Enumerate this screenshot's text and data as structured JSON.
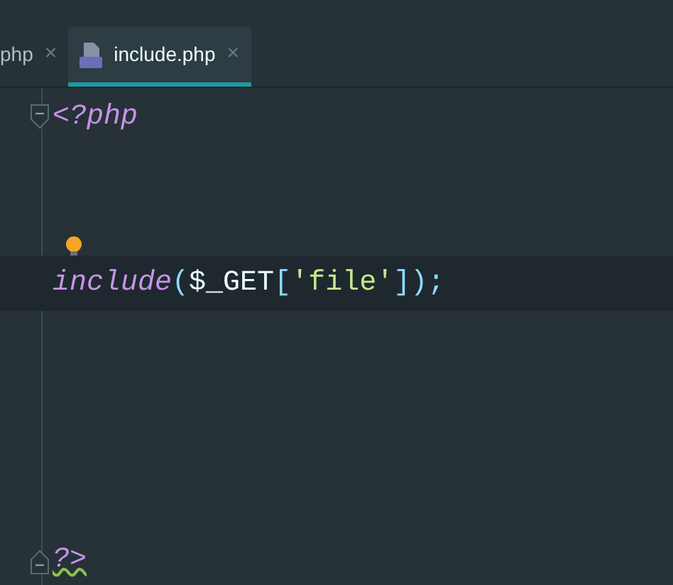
{
  "tabs": [
    {
      "label": "php",
      "selected": false,
      "close": "×"
    },
    {
      "label": "include.php",
      "selected": true,
      "close": "×"
    }
  ],
  "lines": [
    {
      "kind": "fold-start",
      "tokens": [
        {
          "kind": "tag",
          "text": "<?php"
        }
      ]
    },
    {
      "kind": "blank"
    },
    {
      "kind": "blank",
      "bulb": true
    },
    {
      "kind": "code",
      "current": true,
      "tokens": [
        {
          "kind": "keyword",
          "text": "include"
        },
        {
          "kind": "punct",
          "text": "("
        },
        {
          "kind": "variable",
          "text": "$_GET"
        },
        {
          "kind": "punct",
          "text": "["
        },
        {
          "kind": "string",
          "text": "'file'"
        },
        {
          "kind": "punct",
          "text": "])"
        },
        {
          "kind": "plain",
          "text": ";"
        }
      ]
    },
    {
      "kind": "blank"
    },
    {
      "kind": "blank"
    },
    {
      "kind": "blank"
    },
    {
      "kind": "blank"
    },
    {
      "kind": "fold-end",
      "tokens": [
        {
          "kind": "tag",
          "text": "?>",
          "warning": true
        }
      ]
    }
  ]
}
